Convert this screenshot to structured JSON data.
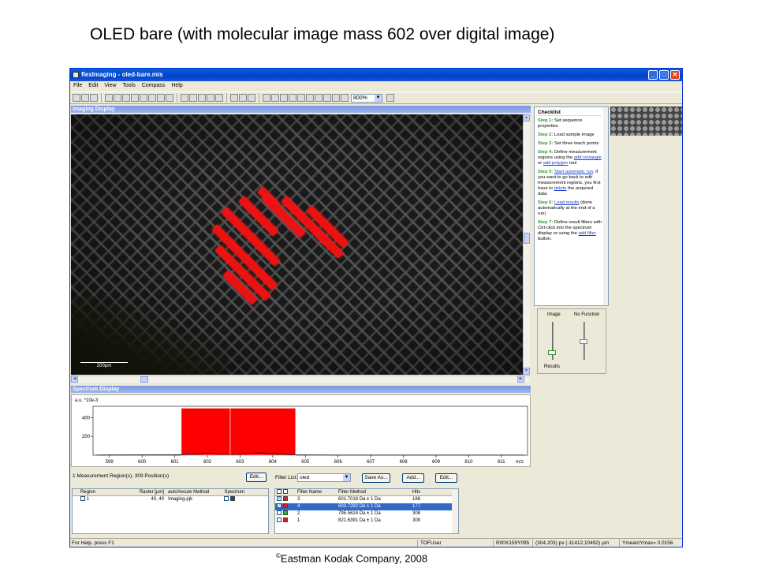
{
  "slide": {
    "title": "OLED bare (with molecular image mass 602 over digital image)",
    "copyright_symbol": "©",
    "copyright": "Eastman Kodak Company, 2008"
  },
  "window": {
    "title": "flexImaging - oled-bare.mis",
    "controls": [
      "_",
      "□",
      "✕"
    ]
  },
  "menu": [
    "File",
    "Edit",
    "View",
    "Tools",
    "Compass",
    "Help"
  ],
  "toolbar": {
    "zoom": "800%"
  },
  "imaging": {
    "header": "Imaging Display",
    "scalebar": "200µm"
  },
  "checklist": {
    "title": "Checklist",
    "steps": [
      {
        "label": "Step 1:",
        "text": "Set sequence properties"
      },
      {
        "label": "Step 2:",
        "text": "Load sample image"
      },
      {
        "label": "Step 3:",
        "text": "Set three teach points"
      },
      {
        "label": "Step 4:",
        "pre": "Define measurement regions using the ",
        "link1": "add rectangle",
        "mid": " or ",
        "link2": "add polygon",
        "post": " tool"
      },
      {
        "label": "Step 5:",
        "link1": "Start automatic run",
        "mid": ". If you want to go back to edit measurement regions, you first have to ",
        "link2": "delete",
        "post": " the acquired data."
      },
      {
        "label": "Step 6:",
        "link1": "Load results",
        "post": " (done automatically at the end of a run)"
      },
      {
        "label": "Step 7:",
        "pre": "Define result filters with Ctrl-click into the spectrum display or using the ",
        "link1": "add filter",
        "post": " button."
      }
    ]
  },
  "sliders": {
    "left_label": "Image",
    "right_label": "No Function",
    "bottom_label": "Results"
  },
  "spectrum": {
    "header": "Spectrum Display",
    "ylabel": "a.u. *10e-3"
  },
  "chart_data": {
    "type": "bar",
    "xlabel": "m/z",
    "ylabel": "a.u. *10e-3",
    "x_ticks": [
      "599",
      "600",
      "601",
      "602",
      "603",
      "604",
      "605",
      "606",
      "607",
      "608",
      "609",
      "610",
      "611"
    ],
    "y_ticks": [
      "200",
      "400"
    ],
    "xlim": [
      598.5,
      611.8
    ],
    "ylim": [
      0,
      520
    ],
    "filter_bands": [
      {
        "filter": "3",
        "start": 601.2,
        "end": 602.7
      },
      {
        "filter": "4",
        "start": 602.7,
        "end": 604.7
      }
    ],
    "band_height": 500,
    "spectrum_trace": [
      [
        598.6,
        2
      ],
      [
        600,
        3
      ],
      [
        601,
        4
      ],
      [
        601.6,
        8
      ],
      [
        602,
        22
      ],
      [
        602.4,
        10
      ],
      [
        602.8,
        6
      ],
      [
        603.2,
        14
      ],
      [
        603.6,
        26
      ],
      [
        604,
        12
      ],
      [
        604.6,
        4
      ],
      [
        606,
        2
      ],
      [
        611.7,
        2
      ]
    ]
  },
  "regions": {
    "caption": "1 Measurement Region(s), 309 Position(s)",
    "edit_label": "Edit...",
    "columns": [
      "Region",
      "Raster [µm]",
      "autoXecute Method",
      "Spectrum"
    ],
    "rows": [
      {
        "region": "1",
        "raster": "40, 40",
        "method": "Imaging-pjk",
        "color": "#3333aa"
      }
    ]
  },
  "filters": {
    "caption": "Filter List:",
    "selected": "oled",
    "save_as_label": "Save As...",
    "add_label": "Add...",
    "edit_label": "Edit...",
    "columns": [
      "Filter Name",
      "Filter Method",
      "Hits"
    ],
    "rows": [
      {
        "checked": true,
        "color": "#e02020",
        "name": "3",
        "method": "601.7018 Da ± 1 Da",
        "hits": "186",
        "selected": false
      },
      {
        "checked": true,
        "color": "#e02020",
        "name": "4",
        "method": "603.7282 Da ± 1 Da",
        "hits": "177",
        "selected": true
      },
      {
        "checked": false,
        "color": "#20c020",
        "name": "2",
        "method": "795.5624 Da ± 1 Da",
        "hits": "308",
        "selected": false
      },
      {
        "checked": false,
        "color": "#e02020",
        "name": "1",
        "method": "821.6391 Da ± 1 Da",
        "hits": "309",
        "selected": false
      }
    ]
  },
  "status": {
    "help": "For Help, press F1",
    "user": "TOFUser",
    "position_id": "R00X159Y095",
    "coords": "(304,203) px  (-11412,10492) µm",
    "ymean": "Ymean/Ymax= 0.0156"
  }
}
